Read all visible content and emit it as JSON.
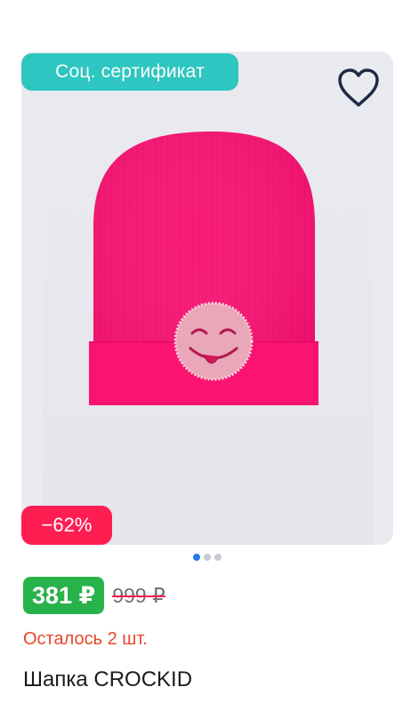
{
  "product": {
    "badge_label": "Соц. сертификат",
    "discount_label": "−62%",
    "price": "381 ₽",
    "old_price": "999 ₽",
    "stock_text": "Осталось 2 шт.",
    "title": "Шапка CROCKID",
    "favorite_icon": "heart-outline-icon",
    "image": "pink-beanie-with-smiley-rhinestone-patch"
  },
  "gallery": {
    "count": 3,
    "active_index": 0
  },
  "colors": {
    "badge_teal": "#2ec6c0",
    "discount_red": "#ff1e52",
    "price_green": "#27b24a",
    "stock_red": "#e8462a",
    "hat_pink": "#fb0f73",
    "dot_active": "#1f7be8"
  }
}
